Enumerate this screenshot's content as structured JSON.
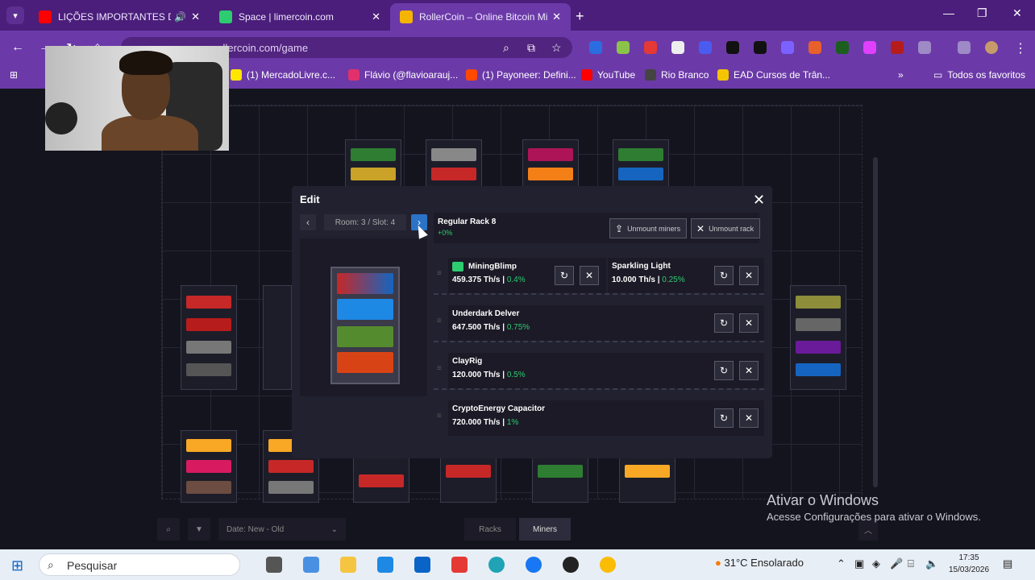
{
  "browser": {
    "tabs": [
      {
        "title": "LIÇÕES IMPORTANTES DE V",
        "favicon_color": "#ff0000",
        "audio_icon": "speaker-icon",
        "active": false
      },
      {
        "title": "Space | limercoin.com",
        "favicon_color": "#2ecc71",
        "active": false
      },
      {
        "title": "RollerCoin – Online Bitcoin Min",
        "favicon_color": "#f5b400",
        "active": true
      }
    ],
    "address": "rollercoin.com/game",
    "bookmarks": [
      {
        "label": "(1) MercadoLivre.c...",
        "color": "#ffe600"
      },
      {
        "label": "Flávio (@flavioarauj...",
        "color": "#e1306c"
      },
      {
        "label": "(1) Payoneer: Defini...",
        "color": "#ff4800"
      },
      {
        "label": "YouTube",
        "color": "#ff0000"
      },
      {
        "label": "Rio Branco",
        "color": "#444444"
      },
      {
        "label": "EAD Cursos de Trân...",
        "color": "#f5c400"
      }
    ],
    "all_bookmarks": "Todos os favoritos",
    "accent": "#6b3aa8"
  },
  "modal": {
    "title": "Edit",
    "slot_label": "Room: 3 / Slot: 4",
    "rack_name": "Regular Rack 8",
    "rack_bonus": "+0%",
    "unmount_miners": "Unmount miners",
    "unmount_rack": "Unmount rack",
    "rows": [
      {
        "miners": [
          {
            "name": "MiningBlimp",
            "power": "459.375 Th/s",
            "bonus": "0.4%",
            "level_badge": true
          },
          {
            "name": "Sparkling Light",
            "power": "10.000 Th/s",
            "bonus": "0.25%"
          }
        ]
      },
      {
        "miners": [
          {
            "name": "Underdark Delver",
            "power": "647.500 Th/s",
            "bonus": "0.75%"
          }
        ]
      },
      {
        "miners": [
          {
            "name": "ClayRig",
            "power": "120.000 Th/s",
            "bonus": "0.5%"
          }
        ]
      },
      {
        "miners": [
          {
            "name": "CryptoEnergy Capacitor",
            "power": "720.000 Th/s",
            "bonus": "1%"
          }
        ]
      }
    ],
    "bonus_color": "#2ecc71"
  },
  "bottom": {
    "sort": "Date: New - Old",
    "tab_racks": "Racks",
    "tab_miners": "Miners"
  },
  "watermark": {
    "line1": "Ativar o Windows",
    "line2": "Acesse Configurações para ativar o Windows."
  },
  "taskbar": {
    "search": "Pesquisar",
    "temperature": "31°C",
    "weather": "Ensolarado",
    "time": "17:35",
    "date": "15/03/2026"
  }
}
